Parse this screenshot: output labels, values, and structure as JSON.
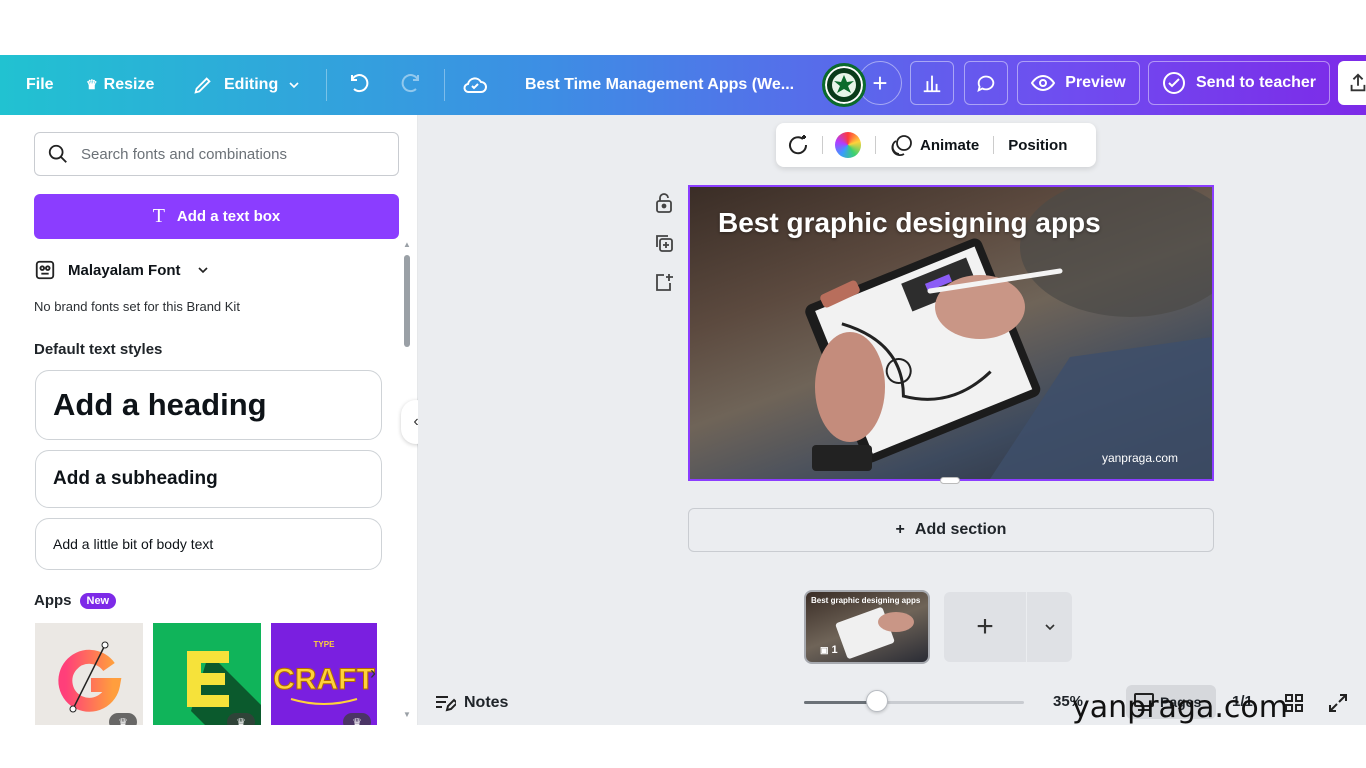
{
  "topbar": {
    "file_label": "File",
    "resize_label": "Resize",
    "editing_label": "Editing",
    "doc_title": "Best Time Management Apps (We...",
    "preview_label": "Preview",
    "send_label": "Send to teacher"
  },
  "float_toolbar": {
    "animate_label": "Animate",
    "position_label": "Position"
  },
  "panel": {
    "search_placeholder": "Search fonts and combinations",
    "add_text_label": "Add a text box",
    "brand_font": "Malayalam Font",
    "no_brand_text": "No brand fonts set for this Brand Kit",
    "default_styles_title": "Default text styles",
    "heading_label": "Add a heading",
    "subheading_label": "Add a subheading",
    "body_label": "Add a little bit of body text",
    "apps_title": "Apps",
    "apps_badge": "New",
    "apps": [
      {
        "name": "G",
        "bg": "#e9e6e2"
      },
      {
        "name": "E",
        "bg": "#10b45a"
      },
      {
        "name": "CRAFT",
        "sub": "TYPE",
        "bg": "#7a1fe0"
      }
    ]
  },
  "canvas": {
    "design_title": "Best graphic designing apps",
    "design_credit": "yanpraga.com",
    "add_section_label": "Add section"
  },
  "pages_strip": {
    "thumb_title": "Best graphic designing apps",
    "thumb_count": "1"
  },
  "bottombar": {
    "notes_label": "Notes",
    "zoom_value": "35%",
    "zoom_fraction": 0.33,
    "pages_label": "Pages",
    "page_count": "1/1"
  },
  "watermark": "yanpraga.com",
  "colors": {
    "accent": "#8b3dff",
    "topbar_start": "#21c2d1",
    "topbar_end": "#7d2ae8"
  }
}
